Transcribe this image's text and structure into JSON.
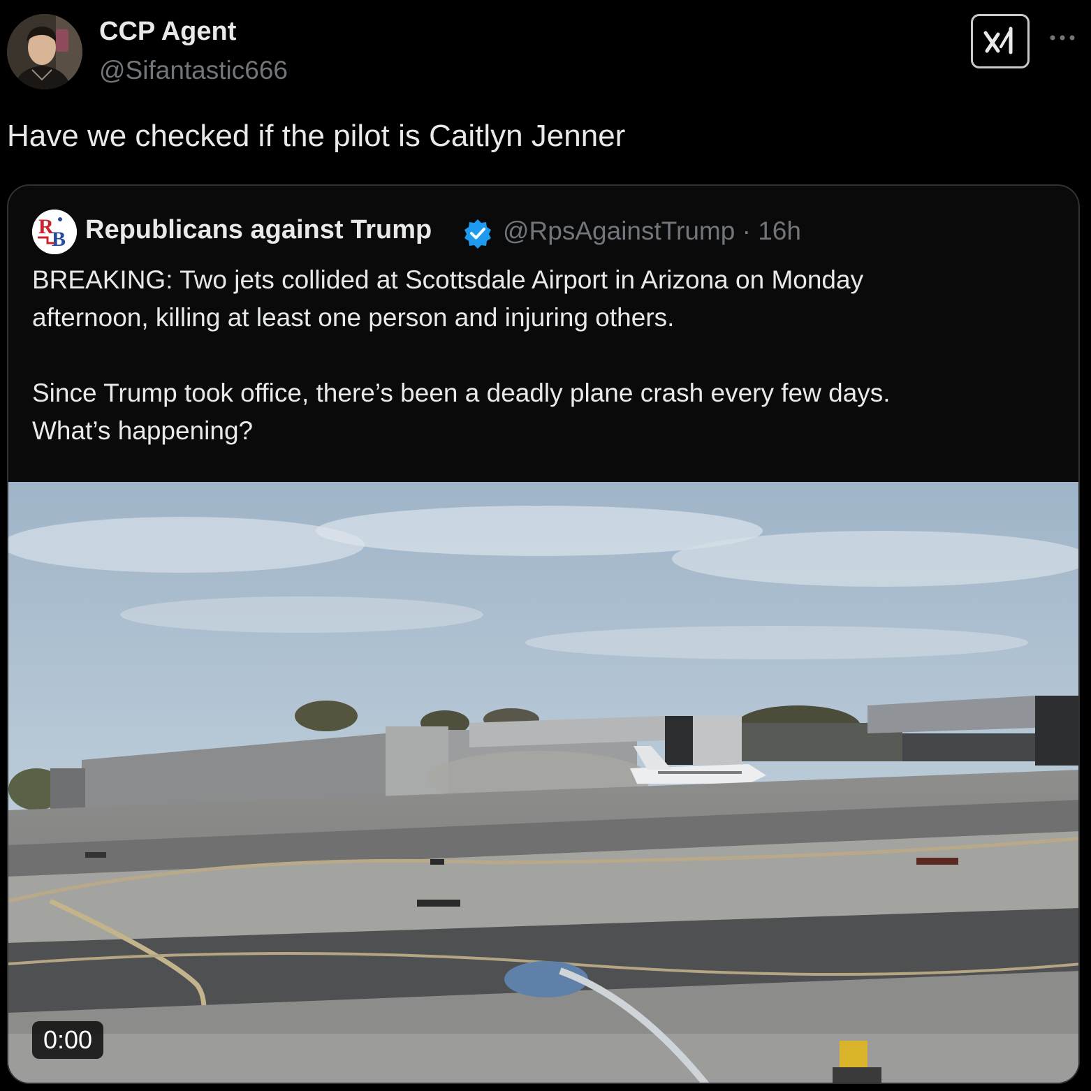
{
  "author": {
    "name": "CCP Agent",
    "handle": "@Sifantastic666"
  },
  "header": {
    "grok_icon": "grok-x-icon",
    "more_icon": "more-dots-icon"
  },
  "tweet": {
    "text": "Have we checked if the pilot is Caitlyn Jenner"
  },
  "quote": {
    "author_name": "Republicans against Trump",
    "verified": true,
    "handle": "@RpsAgainstTrump",
    "separator": "·",
    "time": "16h",
    "paragraphs": [
      "BREAKING: Two jets collided at Scottsdale Airport in Arizona on Monday\nafternoon, killing at least one person and injuring others.",
      "Since Trump took office, there’s been a deadly plane crash every few days.\nWhat’s happening?"
    ],
    "video": {
      "timestamp": "0:00"
    }
  },
  "colors": {
    "background": "#000000",
    "text_primary": "#e7e9ea",
    "text_secondary": "#71767b",
    "verified": "#1d9bf0",
    "card_border": "#2f3336"
  }
}
